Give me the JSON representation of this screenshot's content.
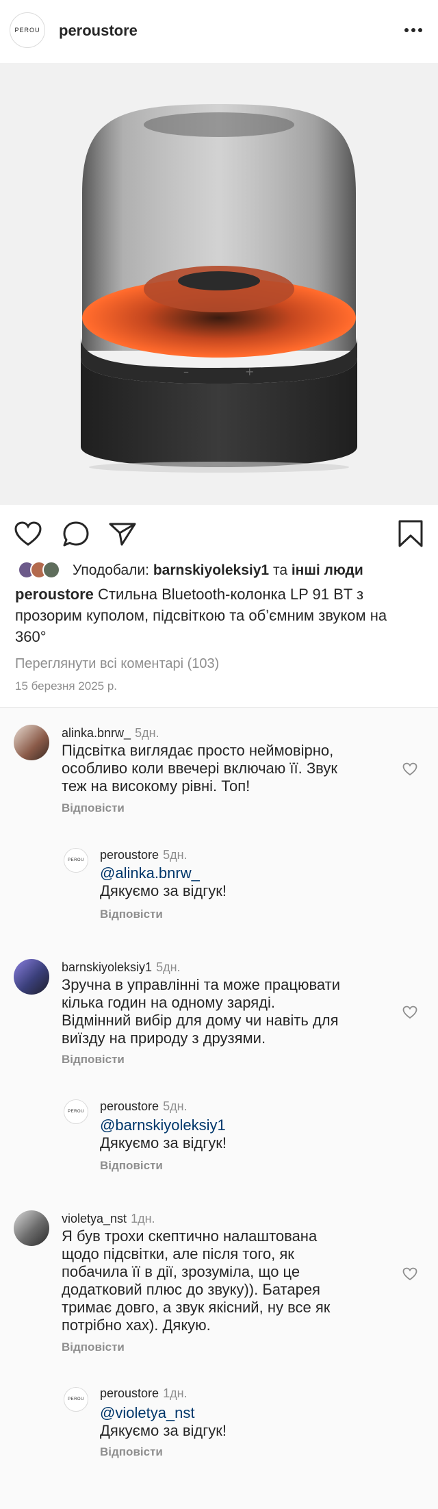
{
  "header": {
    "logo_text": "PEROU",
    "username": "peroustore"
  },
  "post": {
    "likes_prefix": "Уподобали:",
    "likes_user": "barnskiyoleksiy1",
    "likes_mid": "та",
    "likes_others": "інші люди",
    "author": "peroustore",
    "caption": "Стильна Bluetooth-колонка LP 91 BT з прозорим куполом, підсвіткою та об’ємним звуком на 360°",
    "view_all": "Переглянути всі коментарі (103)",
    "date": "15 березня 2025 р."
  },
  "colors": {
    "accent": "#00376b",
    "muted": "#8e8e8e",
    "glow": "#ff5a22"
  },
  "comments": [
    {
      "user": "alinka.bnrw_",
      "age": "5дн.",
      "lines": [
        "Підсвітка виглядає просто неймовірно,",
        "особливо коли ввечері включаю її. Звук",
        "теж на високому рівні. Топ!"
      ],
      "reply_label": "Відповісти",
      "response": {
        "user": "peroustore",
        "age": "5дн.",
        "mention": "@alinka.bnrw_",
        "text": "Дякуємо за відгук!",
        "reply_label": "Відповісти"
      }
    },
    {
      "user": "barnskiyoleksiy1",
      "age": "5дн.",
      "lines": [
        "Зручна в управлінні та може працювати",
        "кілька годин на одному заряді.",
        "Відмінний вибір для дому чи навіть для",
        "виїзду на природу з друзями."
      ],
      "reply_label": "Відповісти",
      "response": {
        "user": "peroustore",
        "age": "5дн.",
        "mention": "@barnskiyoleksiy1",
        "text": "Дякуємо за відгук!",
        "reply_label": "Відповісти"
      }
    },
    {
      "user": "violetya_nst",
      "age": "1дн.",
      "lines": [
        "Я був трохи скептично налаштована",
        "щодо підсвітки, але після того, як",
        "побачила її в дії, зрозуміла, що це",
        "додатковий плюс до звуку)). Батарея",
        "тримає довго, а звук якісний, ну все як",
        "потрібно хах). Дякую."
      ],
      "reply_label": "Відповісти",
      "response": {
        "user": "peroustore",
        "age": "1дн.",
        "mention": "@violetya_nst",
        "text": "Дякуємо за відгук!",
        "reply_label": "Відповісти"
      }
    }
  ],
  "icons": [
    "heart-icon",
    "comment-icon",
    "share-icon",
    "bookmark-icon",
    "more-icon"
  ]
}
